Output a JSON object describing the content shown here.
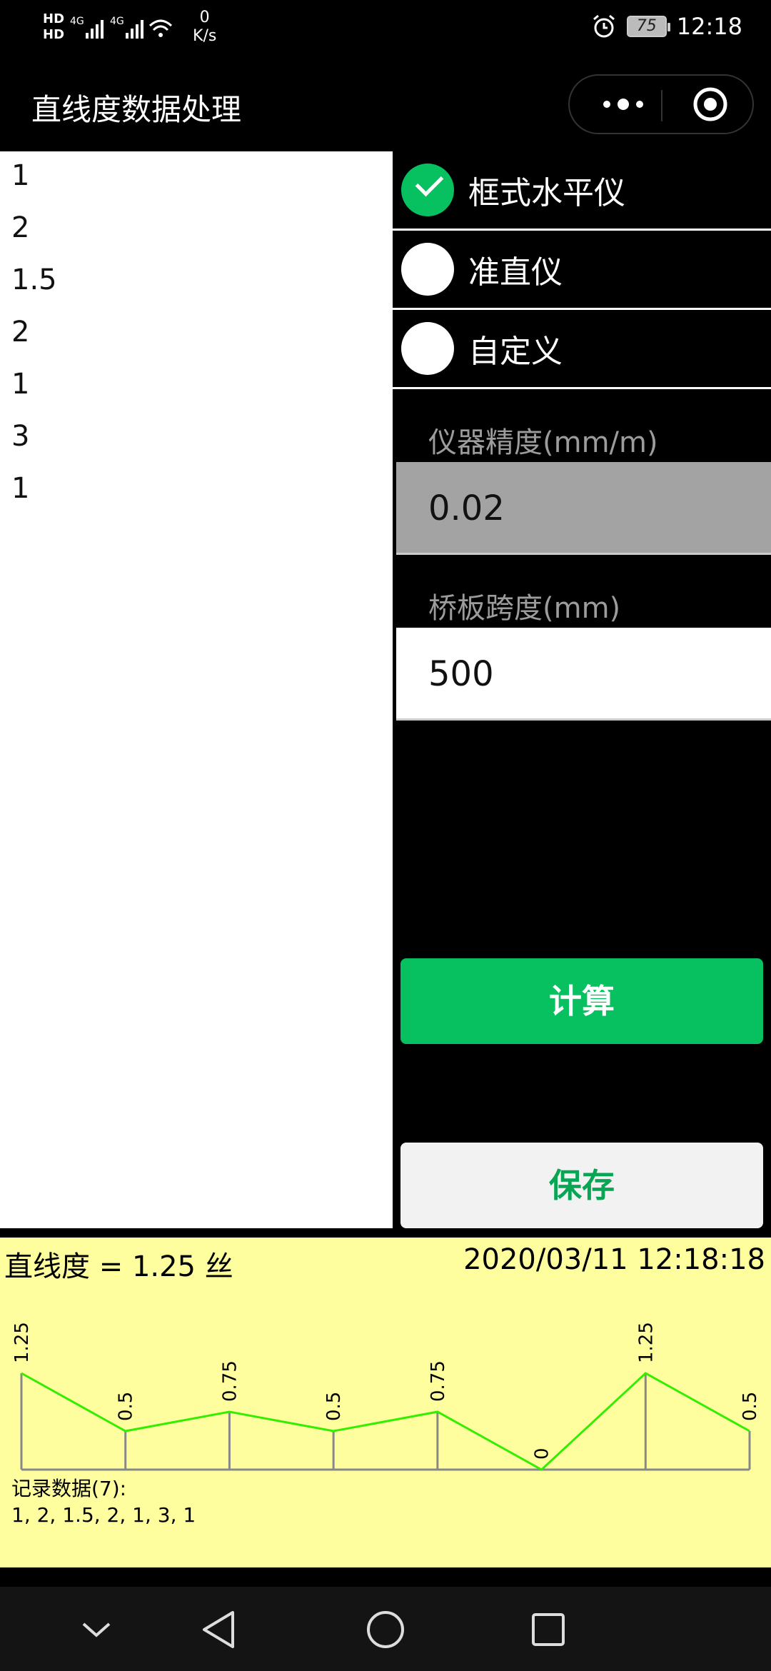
{
  "status_bar": {
    "hd1": "HD",
    "hd2": "HD",
    "net_speed_value": "0",
    "net_speed_unit": "K/s",
    "battery": "75",
    "time": "12:18"
  },
  "nav": {
    "title": "直线度数据处理"
  },
  "data_list": {
    "items": [
      "1",
      "2",
      "1.5",
      "2",
      "1",
      "3",
      "1"
    ]
  },
  "instrument": {
    "options": [
      {
        "label": "框式水平仪",
        "checked": true
      },
      {
        "label": "准直仪",
        "checked": false
      },
      {
        "label": "自定义",
        "checked": false
      }
    ]
  },
  "fields": {
    "precision_label": "仪器精度(mm/m)",
    "precision_value": "0.02",
    "span_label": "桥板跨度(mm)",
    "span_value": "500"
  },
  "buttons": {
    "calculate": "计算",
    "save": "保存"
  },
  "result": {
    "title": "直线度 = 1.25 丝",
    "timestamp": "2020/03/11 12:18:18",
    "record_label": "记录数据(7):",
    "record_values": "1, 2, 1.5, 2, 1, 3, 1"
  },
  "colors": {
    "accent": "#07c160",
    "result_bg": "#fffe9f",
    "line": "#33ee00"
  },
  "chart_data": {
    "type": "line",
    "x": [
      0,
      1,
      2,
      3,
      4,
      5,
      6,
      7
    ],
    "values": [
      1.25,
      0.5,
      0.75,
      0.5,
      0.75,
      0,
      1.25,
      0.5
    ],
    "data_labels": [
      "1.25",
      "0.5",
      "0.75",
      "0.5",
      "0.75",
      "0",
      "1.25",
      "0.5"
    ],
    "ylim": [
      0,
      1.25
    ],
    "grid": false,
    "title": "",
    "xlabel": "",
    "ylabel": ""
  }
}
